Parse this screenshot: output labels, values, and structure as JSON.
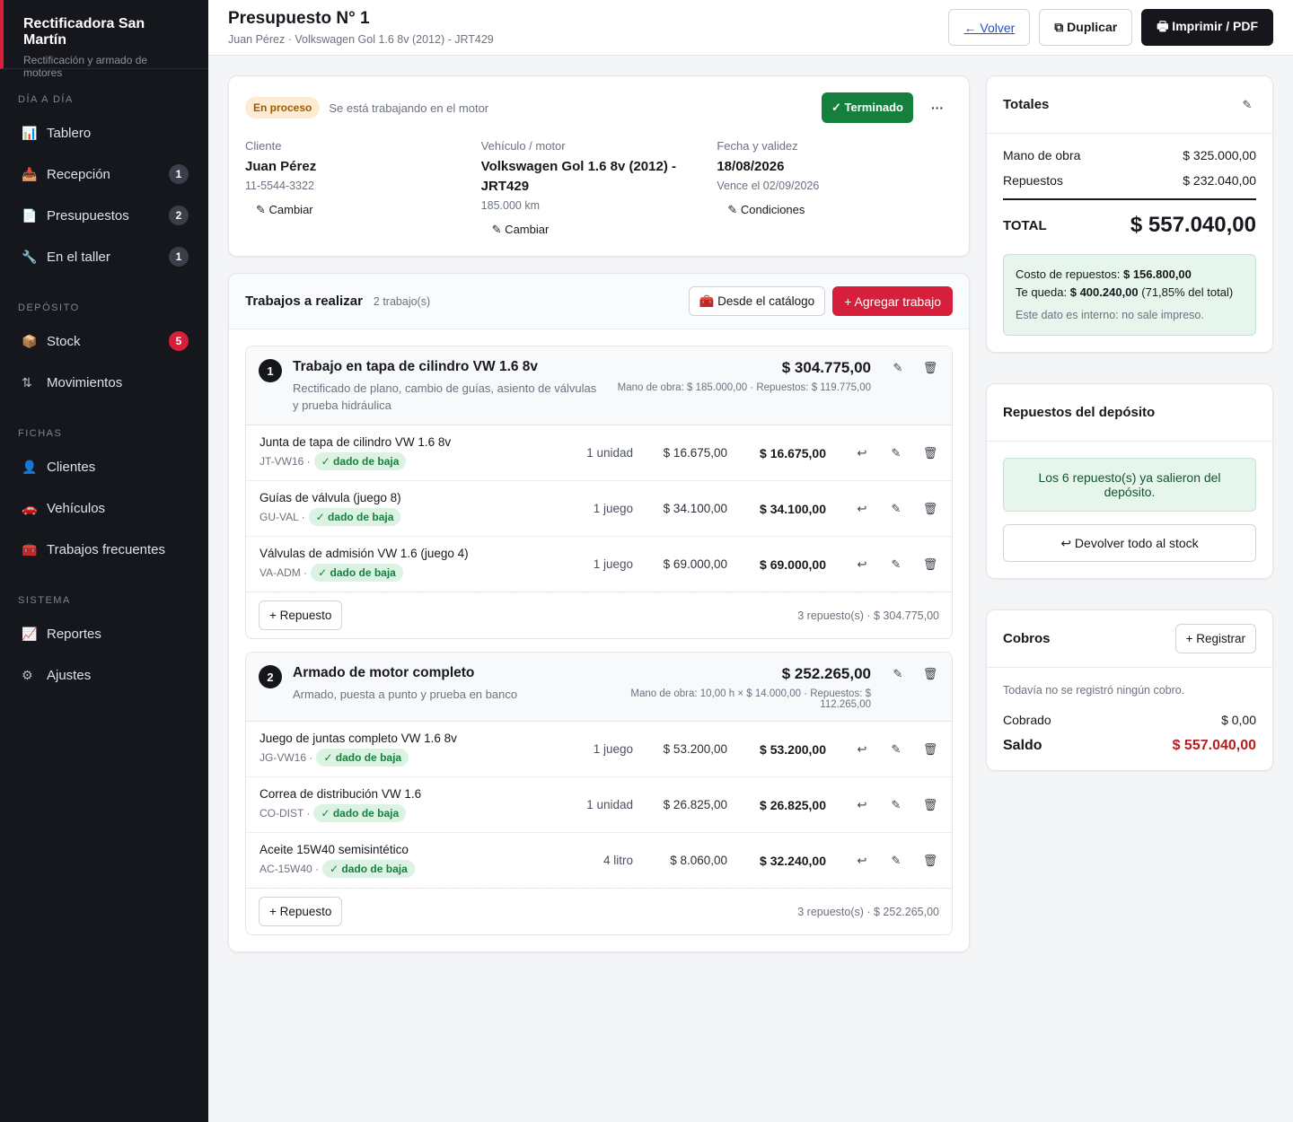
{
  "brand": {
    "name": "Rectificadora San Martín",
    "sub": "Rectificación y armado de motores"
  },
  "nav": [
    {
      "section": "Día a día",
      "items": [
        {
          "icon": "📊",
          "name": "tablero",
          "label": "Tablero",
          "badge": ""
        },
        {
          "icon": "📥",
          "name": "recepcion",
          "label": "Recepción",
          "badge": "1"
        },
        {
          "icon": "📄",
          "name": "presupuestos",
          "label": "Presupuestos",
          "badge": "2"
        },
        {
          "icon": "🔧",
          "name": "en-el-taller",
          "label": "En el taller",
          "badge": "1"
        }
      ]
    },
    {
      "section": "Depósito",
      "items": [
        {
          "icon": "📦",
          "name": "stock",
          "label": "Stock",
          "badge": "5",
          "badge_red": true
        },
        {
          "icon": "⇅",
          "name": "movimientos",
          "label": "Movimientos",
          "badge": ""
        }
      ]
    },
    {
      "section": "Fichas",
      "items": [
        {
          "icon": "👤",
          "name": "clientes",
          "label": "Clientes",
          "badge": ""
        },
        {
          "icon": "🚗",
          "name": "vehiculos",
          "label": "Vehículos",
          "badge": ""
        },
        {
          "icon": "🧰",
          "name": "trabajos-frecuentes",
          "label": "Trabajos frecuentes",
          "badge": ""
        }
      ]
    },
    {
      "section": "Sistema",
      "items": [
        {
          "icon": "📈",
          "name": "reportes",
          "label": "Reportes",
          "badge": ""
        },
        {
          "icon": "⚙",
          "name": "ajustes",
          "label": "Ajustes",
          "badge": ""
        }
      ]
    }
  ],
  "header": {
    "title": "Presupuesto N° 1",
    "subtitle": "Juan Pérez · Volkswagen Gol 1.6 8v (2012) - JRT429",
    "back": "← Volver",
    "duplicate": "⧉ Duplicar",
    "print": "🖶 Imprimir / PDF"
  },
  "summary": {
    "status": "En proceso",
    "status_desc": "Se está trabajando en el motor",
    "done_button": "✓ Terminado",
    "more": "···",
    "client_label": "Cliente",
    "client_name": "Juan Pérez",
    "client_phone": "11-5544-3322",
    "client_change": "✎ Cambiar",
    "vehicle_label": "Vehículo / motor",
    "vehicle_name": "Volkswagen Gol 1.6 8v (2012) - JRT429",
    "vehicle_km": "185.000 km",
    "vehicle_change": "✎ Cambiar",
    "date_label": "Fecha y validez",
    "date_value": "18/08/2026",
    "date_expires": "Vence el 02/09/2026",
    "conditions": "✎ Condiciones"
  },
  "jobs_panel": {
    "title": "Trabajos a realizar",
    "count": "2 trabajo(s)",
    "catalog_button": "🧰 Desde el catálogo",
    "add_button": "+ Agregar trabajo",
    "add_part": "+ Repuesto"
  },
  "jobs": [
    {
      "num": "1",
      "title": "Trabajo en tapa de cilindro VW 1.6 8v",
      "desc": "Rectificado de plano, cambio de guías, asiento de válvulas y prueba hidráulica",
      "total": "$ 304.775,00",
      "breakdown": "Mano de obra: $ 185.000,00 · Repuestos: $ 119.775,00",
      "parts": [
        {
          "name": "Junta de tapa de cilindro VW 1.6 8v",
          "code": "JT-VW16 ·",
          "status": "✓ dado de baja",
          "qty": "1 unidad",
          "unit": "$ 16.675,00",
          "sub": "$ 16.675,00"
        },
        {
          "name": "Guías de válvula (juego 8)",
          "code": "GU-VAL ·",
          "status": "✓ dado de baja",
          "qty": "1 juego",
          "unit": "$ 34.100,00",
          "sub": "$ 34.100,00"
        },
        {
          "name": "Válvulas de admisión VW 1.6 (juego 4)",
          "code": "VA-ADM ·",
          "status": "✓ dado de baja",
          "qty": "1 juego",
          "unit": "$ 69.000,00",
          "sub": "$ 69.000,00"
        }
      ],
      "footer": "3 repuesto(s) · $ 304.775,00"
    },
    {
      "num": "2",
      "title": "Armado de motor completo",
      "desc": "Armado, puesta a punto y prueba en banco",
      "total": "$ 252.265,00",
      "breakdown": "Mano de obra: 10,00 h × $ 14.000,00 · Repuestos: $ 112.265,00",
      "parts": [
        {
          "name": "Juego de juntas completo VW 1.6 8v",
          "code": "JG-VW16 ·",
          "status": "✓ dado de baja",
          "qty": "1 juego",
          "unit": "$ 53.200,00",
          "sub": "$ 53.200,00"
        },
        {
          "name": "Correa de distribución VW 1.6",
          "code": "CO-DIST ·",
          "status": "✓ dado de baja",
          "qty": "1 unidad",
          "unit": "$ 26.825,00",
          "sub": "$ 26.825,00"
        },
        {
          "name": "Aceite 15W40 semisintético",
          "code": "AC-15W40 ·",
          "status": "✓ dado de baja",
          "qty": "4 litro",
          "unit": "$ 8.060,00",
          "sub": "$ 32.240,00"
        }
      ],
      "footer": "3 repuesto(s) · $ 252.265,00"
    }
  ],
  "totals": {
    "title": "Totales",
    "labor_label": "Mano de obra",
    "labor_value": "$ 325.000,00",
    "parts_label": "Repuestos",
    "parts_value": "$ 232.040,00",
    "total_label": "TOTAL",
    "total_value": "$ 557.040,00",
    "cost_label": "Costo de repuestos:",
    "cost_value": "$ 156.800,00",
    "keep_label": "Te queda:",
    "keep_value": "$ 400.240,00",
    "keep_pct": "(71,85% del total)",
    "internal_note": "Este dato es interno: no sale impreso."
  },
  "depot": {
    "title": "Repuestos del depósito",
    "ok_message": "Los 6 repuesto(s) ya salieron del depósito.",
    "return_button": "↩ Devolver todo al stock"
  },
  "payments": {
    "title": "Cobros",
    "register": "+ Registrar",
    "empty": "Todavía no se registró ningún cobro.",
    "paid_label": "Cobrado",
    "paid_value": "$ 0,00",
    "balance_label": "Saldo",
    "balance_value": "$ 557.040,00"
  },
  "colors": {
    "accent": "#d61f3a",
    "sidebar": "#15171c",
    "success": "#15803d",
    "warning_bg": "#fdecd2"
  }
}
